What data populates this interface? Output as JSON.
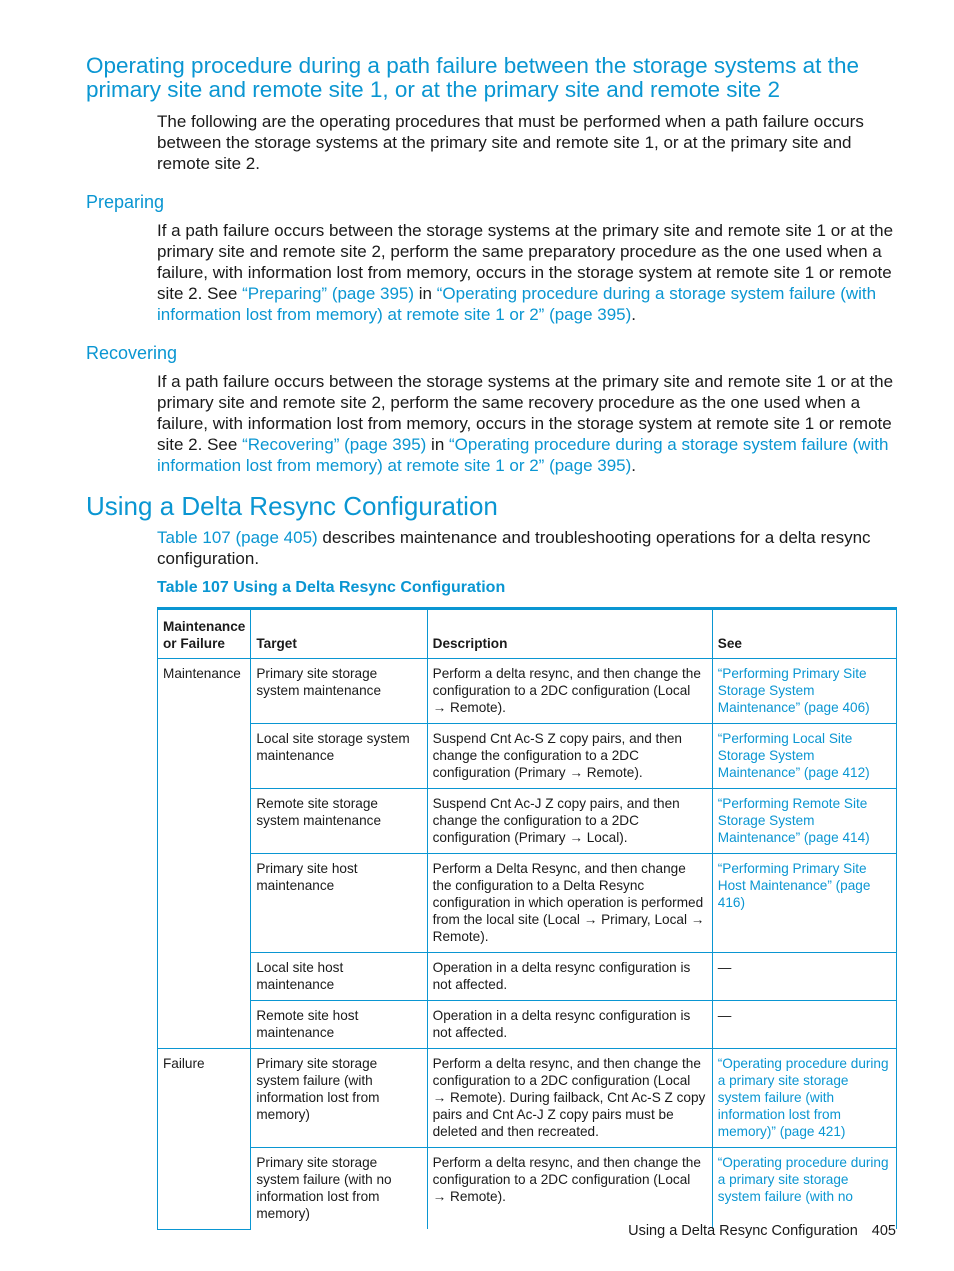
{
  "section1": {
    "heading": "Operating procedure during a path failure between the storage systems at the primary site and remote site 1, or at the primary site and remote site 2",
    "intro": "The following are the operating procedures that must be performed when a path failure occurs between the storage systems at the primary site and remote site 1, or at the primary site and remote site 2."
  },
  "preparing": {
    "heading": "Preparing",
    "text": "If a path failure occurs between the storage systems at the primary site and remote site 1 or at the primary site and remote site 2, perform the same preparatory procedure as the one used when a failure, with information lost from memory, occurs in the storage system at remote site 1 or remote site 2. See ",
    "link1": "“Preparing” (page 395)",
    "mid": " in ",
    "link2": "“Operating procedure during a storage system failure (with information lost from memory) at remote site 1 or 2” (page 395)",
    "end": "."
  },
  "recovering": {
    "heading": "Recovering",
    "text": "If a path failure occurs between the storage systems at the primary site and remote site 1 or at the primary site and remote site 2, perform the same recovery procedure as the one used when a failure, with information lost from memory, occurs in the storage system at remote site 1 or remote site 2. See ",
    "link1": "“Recovering” (page 395)",
    "mid": " in ",
    "link2": "“Operating procedure during a storage system failure (with information lost from memory) at remote site 1 or 2” (page 395)",
    "end": "."
  },
  "section2": {
    "heading": "Using a Delta Resync Configuration",
    "intro_link": "Table 107 (page 405)",
    "intro_text": " describes maintenance and troubleshooting operations for a delta resync configuration.",
    "caption": "Table 107 Using a Delta Resync Configuration"
  },
  "table": {
    "headers": [
      "Maintenance or Failure",
      "Target",
      "Description",
      "See"
    ],
    "groups": [
      {
        "label": "Maintenance",
        "rows": [
          {
            "target": "Primary site storage system maintenance",
            "description": "Perform a delta resync, and then change the configuration to a 2DC configuration (Local → Remote).",
            "see": "“Performing Primary Site Storage System Maintenance” (page 406)"
          },
          {
            "target": "Local site storage system maintenance",
            "description": "Suspend Cnt Ac-S Z copy pairs, and then change the configuration to a 2DC configuration (Primary → Remote).",
            "see": "“Performing Local Site Storage System Maintenance” (page 412)"
          },
          {
            "target": "Remote site storage system maintenance",
            "description": "Suspend Cnt Ac-J Z copy pairs, and then change the configuration to a 2DC configuration (Primary → Local).",
            "see": "“Performing Remote Site Storage System Maintenance” (page 414)"
          },
          {
            "target": "Primary site host maintenance",
            "description": "Perform a Delta Resync, and then change the configuration to a Delta Resync configuration in which operation is performed from the local site (Local → Primary, Local → Remote).",
            "see": "“Performing Primary Site Host Maintenance” (page 416)"
          },
          {
            "target": "Local site host maintenance",
            "description": "Operation in a delta resync configuration is not affected.",
            "see": "—"
          },
          {
            "target": "Remote site host maintenance",
            "description": "Operation in a delta resync configuration is not affected.",
            "see": "—"
          }
        ]
      },
      {
        "label": "Failure",
        "rows": [
          {
            "target": "Primary site storage system failure (with information lost from memory)",
            "description": "Perform a delta resync, and then change the configuration to a 2DC configuration (Local → Remote). During failback, Cnt Ac-S Z copy pairs and Cnt Ac-J Z copy pairs must be deleted and then recreated.",
            "see": "“Operating procedure during a primary site storage system failure (with information lost from memory)” (page 421)"
          },
          {
            "target": "Primary site storage system failure (with no information lost from memory)",
            "description": "Perform a delta resync, and then change the configuration to a 2DC configuration (Local → Remote).",
            "see": "“Operating procedure during a primary site storage system failure (with no"
          }
        ]
      }
    ]
  },
  "footer": {
    "title": "Using a Delta Resync Configuration",
    "page": "405"
  }
}
